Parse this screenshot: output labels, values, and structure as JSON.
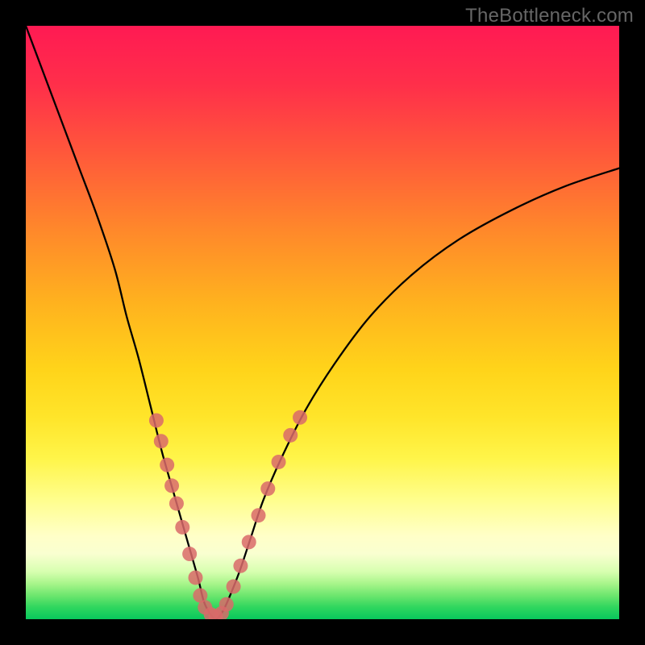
{
  "attribution": "TheBottleneck.com",
  "chart_data": {
    "type": "line",
    "title": "",
    "xlabel": "",
    "ylabel": "",
    "xlim": [
      0,
      100
    ],
    "ylim": [
      0,
      100
    ],
    "grid": false,
    "series": [
      {
        "name": "bottleneck-curve",
        "x": [
          0,
          3,
          6,
          9,
          12,
          15,
          17,
          19,
          21,
          23,
          25,
          27,
          29,
          30,
          31,
          32,
          33,
          34,
          36,
          38,
          40,
          43,
          47,
          52,
          58,
          65,
          73,
          82,
          91,
          100
        ],
        "y": [
          100,
          92,
          84,
          76,
          68,
          59,
          51,
          44,
          36,
          28,
          21,
          14,
          7,
          3,
          1,
          0,
          1,
          3,
          8,
          14,
          20,
          27,
          35,
          43,
          51,
          58,
          64,
          69,
          73,
          76
        ]
      }
    ],
    "markers": [
      {
        "x": 22.0,
        "y": 33.5
      },
      {
        "x": 22.8,
        "y": 30.0
      },
      {
        "x": 23.8,
        "y": 26.0
      },
      {
        "x": 24.6,
        "y": 22.5
      },
      {
        "x": 25.4,
        "y": 19.5
      },
      {
        "x": 26.4,
        "y": 15.5
      },
      {
        "x": 27.6,
        "y": 11.0
      },
      {
        "x": 28.6,
        "y": 7.0
      },
      {
        "x": 29.4,
        "y": 4.0
      },
      {
        "x": 30.2,
        "y": 2.0
      },
      {
        "x": 31.2,
        "y": 0.8
      },
      {
        "x": 32.0,
        "y": 0.5
      },
      {
        "x": 33.0,
        "y": 1.0
      },
      {
        "x": 33.8,
        "y": 2.5
      },
      {
        "x": 35.0,
        "y": 5.5
      },
      {
        "x": 36.2,
        "y": 9.0
      },
      {
        "x": 37.6,
        "y": 13.0
      },
      {
        "x": 39.2,
        "y": 17.5
      },
      {
        "x": 40.8,
        "y": 22.0
      },
      {
        "x": 42.6,
        "y": 26.5
      },
      {
        "x": 44.6,
        "y": 31.0
      },
      {
        "x": 46.2,
        "y": 34.0
      }
    ],
    "background_gradient": {
      "top": "#ff1a53",
      "mid": "#ffd41a",
      "bottom": "#08c85d"
    },
    "curve_color": "#000000",
    "marker_color": "#d96a6a"
  }
}
